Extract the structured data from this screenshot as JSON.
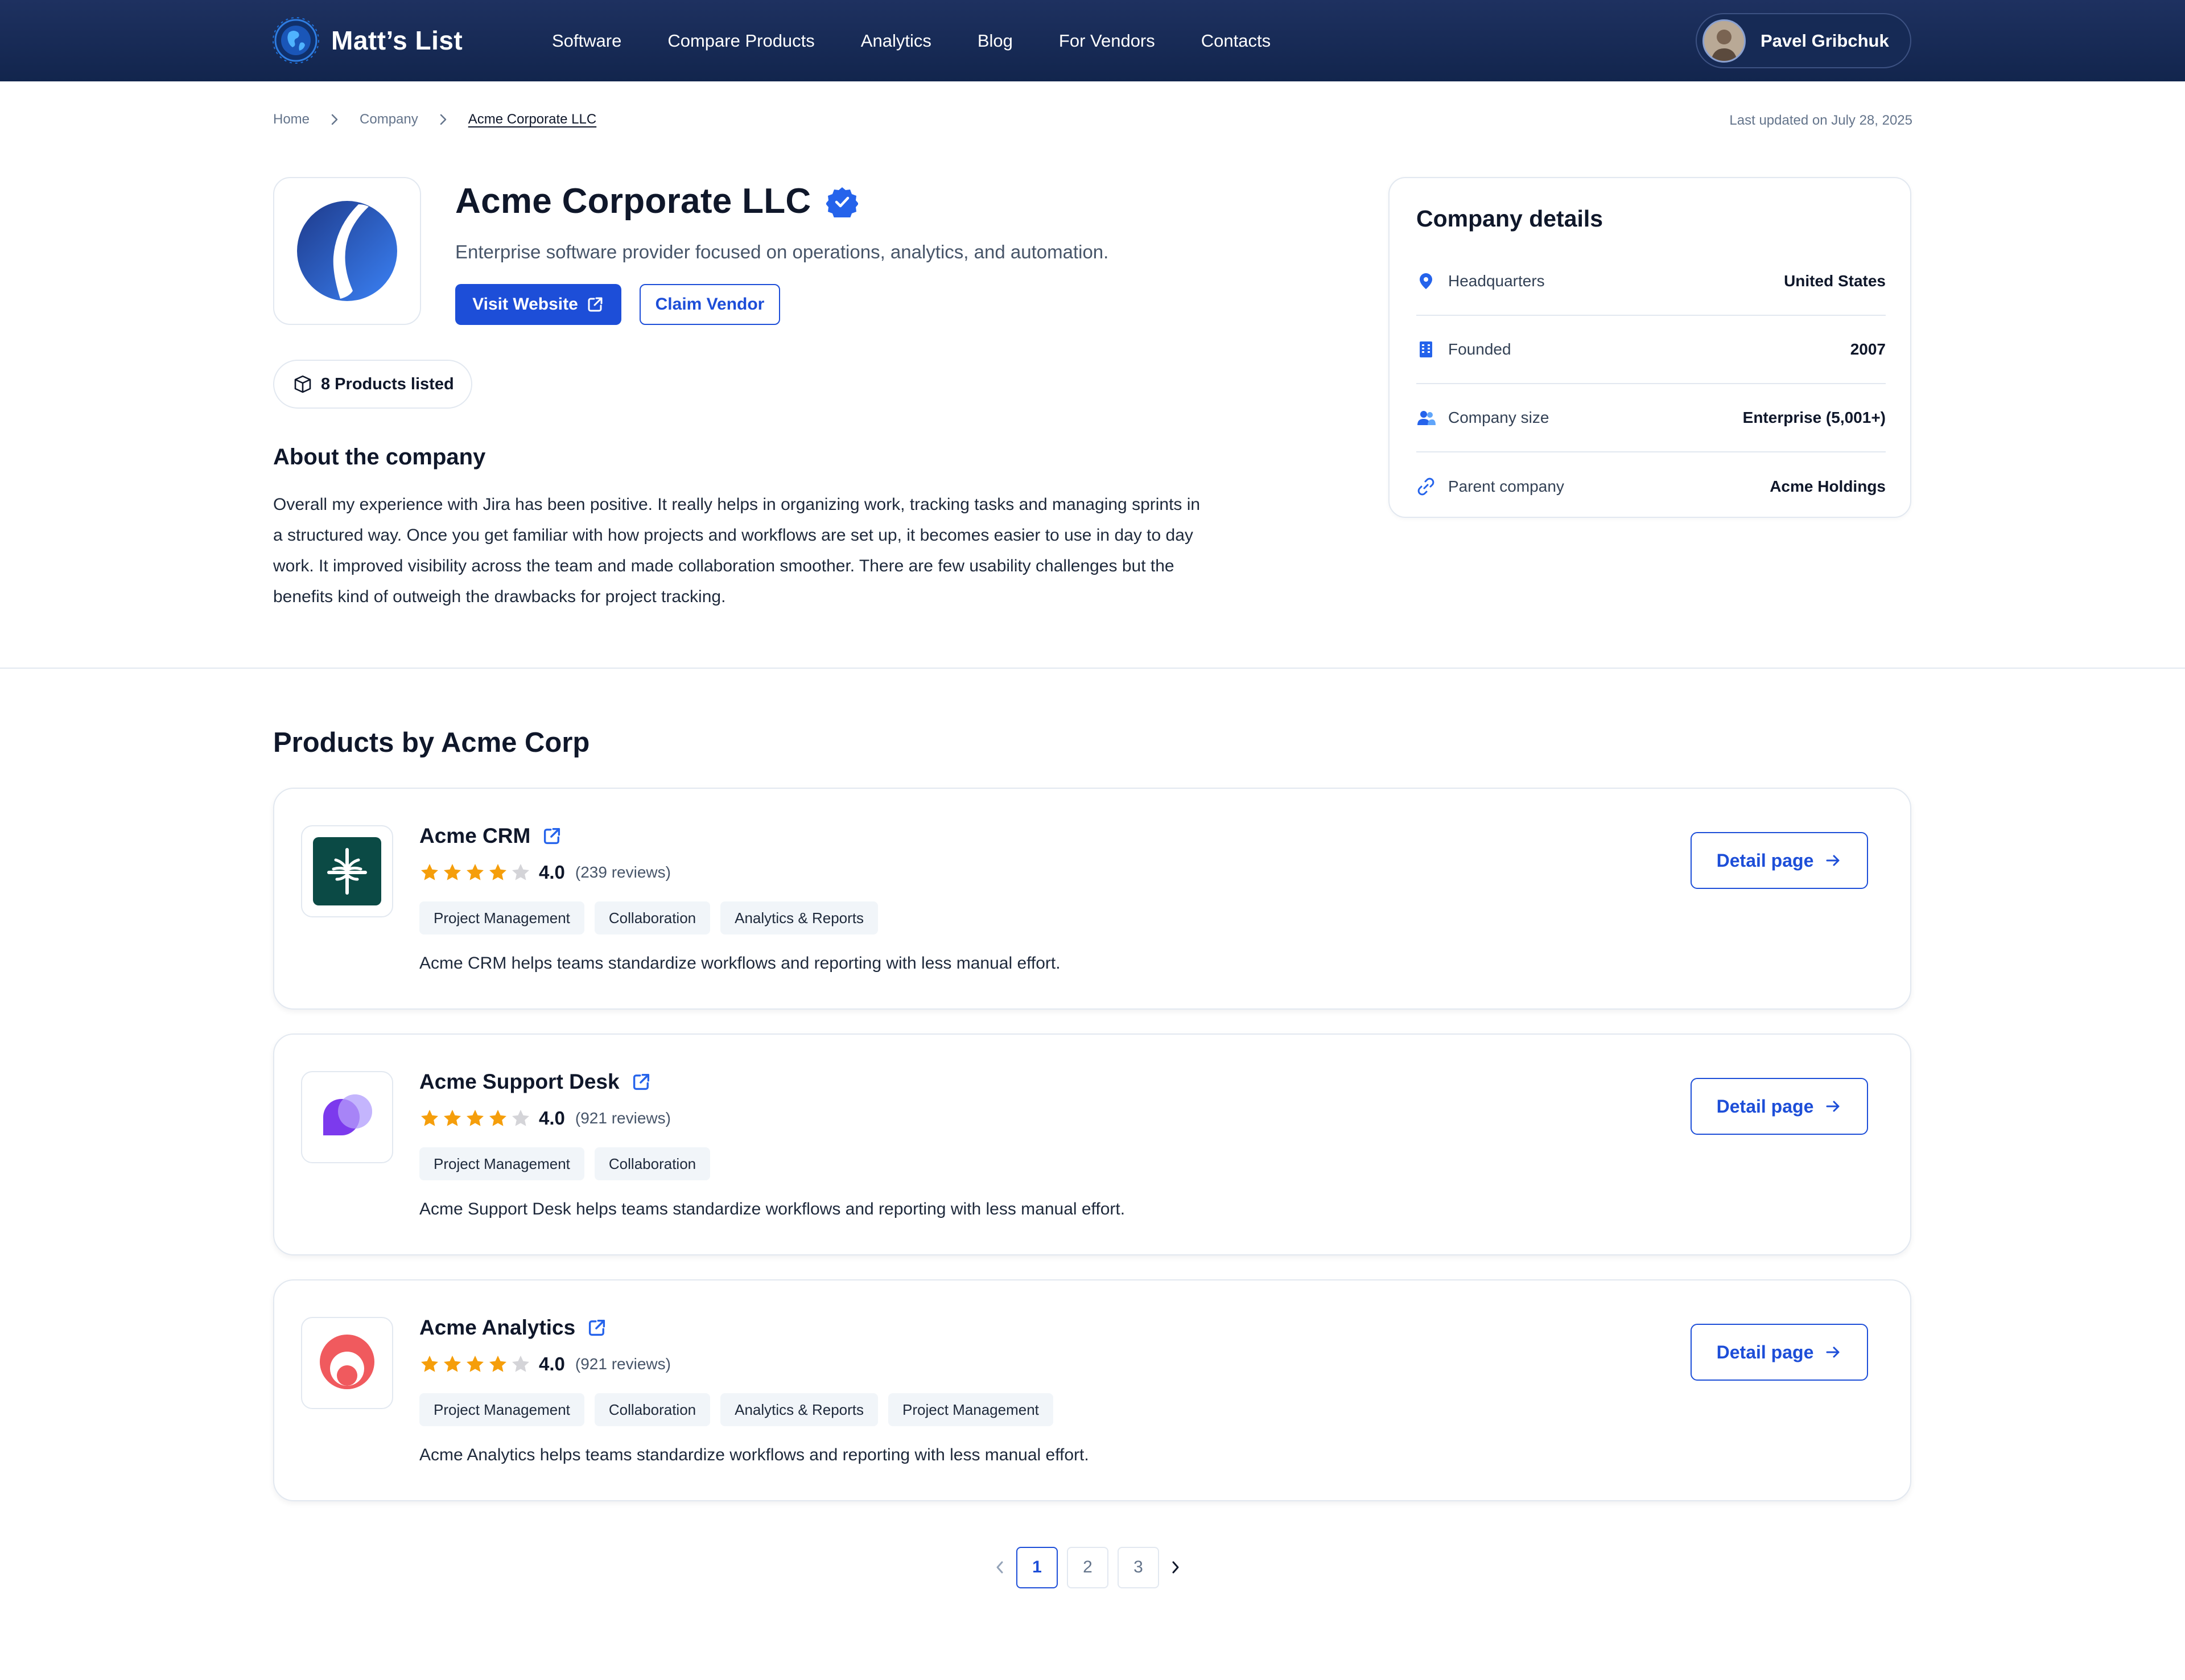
{
  "header": {
    "brand": "Matt’s List",
    "nav": [
      "Software",
      "Compare Products",
      "Analytics",
      "Blog",
      "For Vendors",
      "Contacts"
    ],
    "user_name": "Pavel Gribchuk"
  },
  "breadcrumb": [
    "Home",
    "Company",
    "Acme Corporate LLC"
  ],
  "last_updated": "Last updated on July 28, 2025",
  "company": {
    "name": "Acme Corporate LLC",
    "tagline": "Enterprise software provider focused on operations, analytics, and automation.",
    "visit_label": "Visit Website",
    "claim_label": "Claim Vendor",
    "products_count_label": "8 Products listed",
    "about_title": "About the company",
    "about_text": "Overall my experience with Jira has been positive. It really helps in organizing work, tracking tasks and managing sprints in a structured way. Once you get familiar with how projects and workflows are set up, it becomes easier to use in day to day work. It improved visibility across the team and made collaboration smoother. There are few usability challenges but the benefits kind of outweigh the drawbacks for project tracking."
  },
  "details": {
    "title": "Company details",
    "rows": [
      {
        "icon": "location-pin-icon",
        "label": "Headquarters",
        "value": "United States"
      },
      {
        "icon": "building-icon",
        "label": "Founded",
        "value": "2007"
      },
      {
        "icon": "users-icon",
        "label": "Company size",
        "value": "Enterprise (5,001+)"
      },
      {
        "icon": "link-icon",
        "label": "Parent company",
        "value": "Acme Holdings"
      }
    ]
  },
  "products_section": {
    "title": "Products by Acme Corp",
    "detail_label": "Detail page",
    "items": [
      {
        "name": "Acme CRM",
        "rating": "4.0",
        "stars": 4,
        "reviews": "(239 reviews)",
        "tags": [
          "Project Management",
          "Collaboration",
          "Analytics & Reports"
        ],
        "description": "Acme CRM helps teams standardize workflows and reporting with less manual effort."
      },
      {
        "name": "Acme Support Desk",
        "rating": "4.0",
        "stars": 4,
        "reviews": "(921 reviews)",
        "tags": [
          "Project Management",
          "Collaboration"
        ],
        "description": "Acme Support Desk helps teams standardize workflows and reporting with less manual effort."
      },
      {
        "name": "Acme Analytics",
        "rating": "4.0",
        "stars": 4,
        "reviews": "(921 reviews)",
        "tags": [
          "Project Management",
          "Collaboration",
          "Analytics & Reports",
          "Project Management"
        ],
        "description": "Acme Analytics helps teams standardize workflows and reporting with less manual effort."
      }
    ]
  },
  "pagination": {
    "pages": [
      "1",
      "2",
      "3"
    ],
    "current": "1"
  },
  "colors": {
    "primary": "#1d4ed8",
    "nav_bg": "#1e3160",
    "star": "#f59e0b"
  }
}
